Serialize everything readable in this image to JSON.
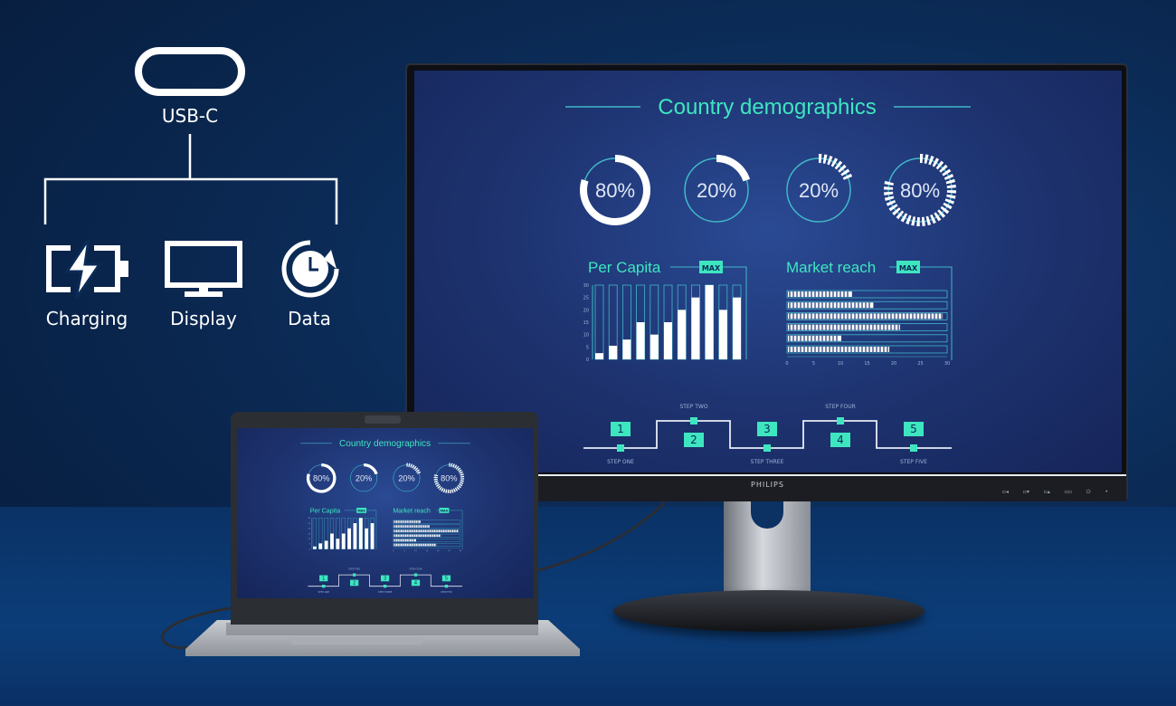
{
  "usb": {
    "label": "USB-C",
    "features": [
      {
        "label": "Charging",
        "icon": "battery-charging-icon"
      },
      {
        "label": "Display",
        "icon": "monitor-icon"
      },
      {
        "label": "Data",
        "icon": "data-sync-clock-icon"
      }
    ]
  },
  "monitor": {
    "brand": "PHILIPS"
  },
  "dashboard": {
    "title": "Country demographics",
    "gauges": [
      {
        "label": "80%",
        "value": 80,
        "style": "solid"
      },
      {
        "label": "20%",
        "value": 20,
        "style": "solid"
      },
      {
        "label": "20%",
        "value": 20,
        "style": "dashed"
      },
      {
        "label": "80%",
        "value": 80,
        "style": "dashed"
      }
    ],
    "per_capita": {
      "title": "Per Capita",
      "badge": "MAX",
      "y_ticks": [
        "0",
        "5",
        "10",
        "15",
        "20",
        "25",
        "30"
      ],
      "ylim": [
        0,
        30
      ],
      "values": [
        2.5,
        5.5,
        8,
        15,
        10,
        15,
        20,
        25,
        30,
        20,
        25
      ]
    },
    "market_reach": {
      "title": "Market reach",
      "badge": "MAX",
      "x_ticks": [
        "0",
        "5",
        "10",
        "15",
        "20",
        "25",
        "30"
      ],
      "xlim": [
        0,
        30
      ],
      "values": [
        12,
        16,
        29,
        21,
        10,
        19
      ]
    },
    "steps": [
      {
        "number": "1",
        "label": "STEP ONE"
      },
      {
        "number": "2",
        "label": "STEP TWO"
      },
      {
        "number": "3",
        "label": "STEP THREE"
      },
      {
        "number": "4",
        "label": "STEP FOUR"
      },
      {
        "number": "5",
        "label": "STEP FIVE"
      }
    ]
  },
  "colors": {
    "accent": "#3ee6c0",
    "teal_line": "#3fb8c8",
    "screen_bg": "#1d326e"
  }
}
